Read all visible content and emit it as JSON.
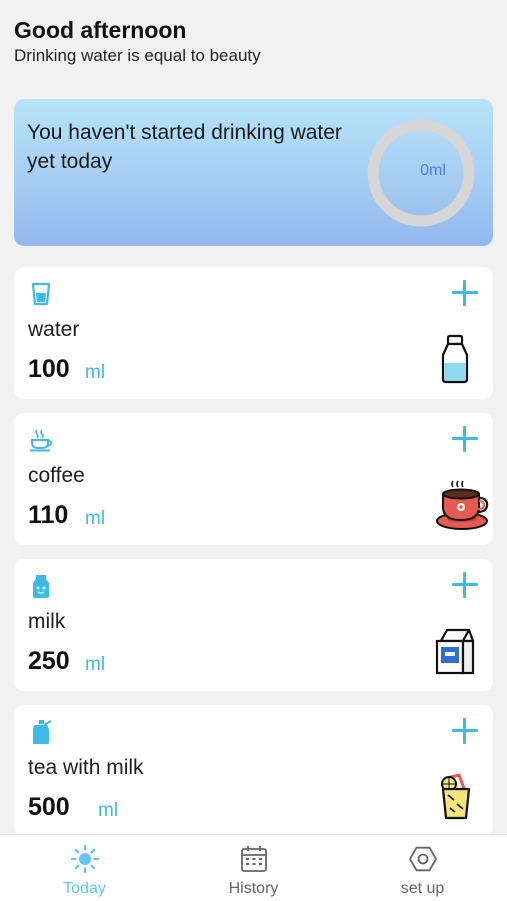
{
  "header": {
    "greeting": "Good afternoon",
    "subtitle": "Drinking water is equal to beauty"
  },
  "summary": {
    "message": "You haven't started drinking water yet today",
    "progress_label": "0ml",
    "progress_value_ml": 0
  },
  "drinks": [
    {
      "name": "water",
      "amount": "100",
      "unit": "ml",
      "icon": "glass-icon",
      "illustration": "water-bottle-icon"
    },
    {
      "name": "coffee",
      "amount": "110",
      "unit": "ml",
      "icon": "coffee-cup-icon",
      "illustration": "hot-coffee-icon"
    },
    {
      "name": "milk",
      "amount": "250",
      "unit": "ml",
      "icon": "milk-bottle-icon",
      "illustration": "milk-carton-icon"
    },
    {
      "name": "tea with milk",
      "amount": "500",
      "unit": "ml",
      "icon": "tea-bottle-icon",
      "illustration": "lemon-tea-icon"
    }
  ],
  "tabs": [
    {
      "label": "Today",
      "icon": "sun-icon",
      "active": true
    },
    {
      "label": "History",
      "icon": "calendar-icon",
      "active": false
    },
    {
      "label": "set up",
      "icon": "settings-hexagon-icon",
      "active": false
    }
  ],
  "colors": {
    "accent": "#3cbbe8",
    "tab_active": "#5ec7ee",
    "progress_text": "#5a76d6",
    "ring": "#d6d6d6",
    "banner_top": "#b7e4f7",
    "banner_bottom": "#93b7ee",
    "background": "#f1f1f1"
  }
}
